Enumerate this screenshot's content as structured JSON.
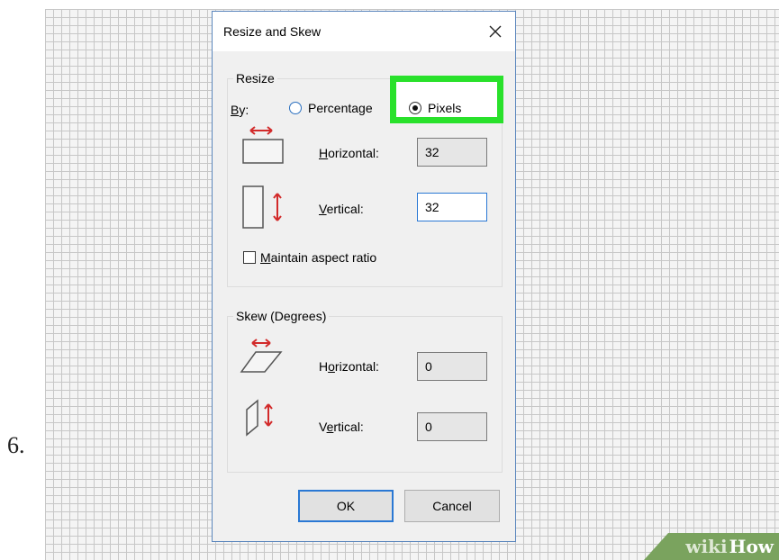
{
  "step": {
    "number": "6."
  },
  "dialog": {
    "title": "Resize and Skew",
    "close_symbol": "✕",
    "resize": {
      "group_label": "Resize",
      "by_label_first": "B",
      "by_label_rest": "y:",
      "percentage_label": "Percentage",
      "pixels_label": "Pixels",
      "selected_mode": "Pixels",
      "horizontal_label_first": "H",
      "horizontal_label_rest": "orizontal:",
      "horizontal_value": "32",
      "vertical_label_first": "V",
      "vertical_label_rest": "ertical:",
      "vertical_value": "32",
      "maintain_first": "M",
      "maintain_rest": "aintain aspect ratio",
      "maintain_checked": false
    },
    "skew": {
      "group_label": "Skew (Degrees)",
      "horizontal_label_a": "H",
      "horizontal_label_u": "o",
      "horizontal_label_b": "rizontal:",
      "horizontal_value": "0",
      "vertical_label_a": "V",
      "vertical_label_u": "e",
      "vertical_label_b": "rtical:",
      "vertical_value": "0"
    },
    "ok_label": "OK",
    "cancel_label": "Cancel"
  },
  "watermark": {
    "wiki": "wiki",
    "how": "How"
  },
  "colors": {
    "highlight": "#29e12b",
    "arrow_red": "#d22a2a",
    "focus_blue": "#2a78d4"
  }
}
